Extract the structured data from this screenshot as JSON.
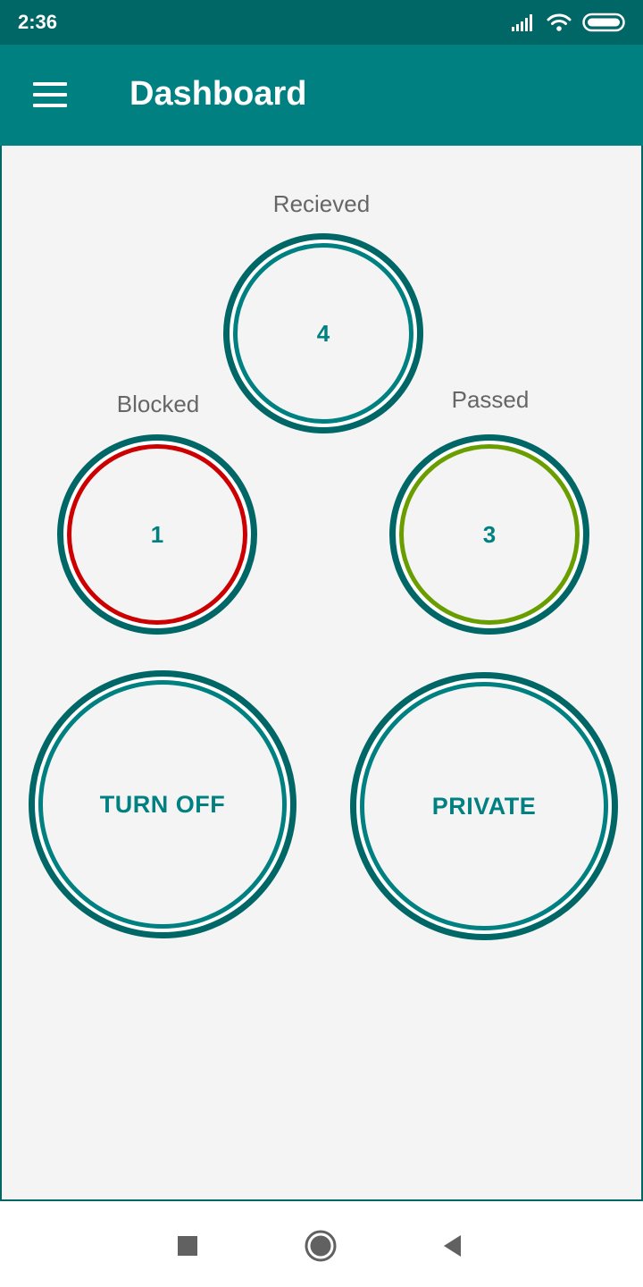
{
  "status_bar": {
    "time": "2:36",
    "icons": [
      "signal-icon",
      "wifi-icon",
      "battery-icon"
    ]
  },
  "app_bar": {
    "menu_icon": "hamburger-menu-icon",
    "title": "Dashboard"
  },
  "stats": {
    "received": {
      "label": "Recieved",
      "value": "4"
    },
    "blocked": {
      "label": "Blocked",
      "value": "1"
    },
    "passed": {
      "label": "Passed",
      "value": "3"
    }
  },
  "actions": {
    "turn_off_label": "TURN OFF",
    "private_label": "PRIVATE"
  },
  "nav_bar": {
    "icons": [
      "recent-apps-icon",
      "home-icon",
      "back-icon"
    ]
  },
  "colors": {
    "primary_dark": "#006666",
    "primary": "#008080",
    "blocked": "#cc0000",
    "passed": "#6a9e00",
    "background": "#f4f4f4"
  }
}
